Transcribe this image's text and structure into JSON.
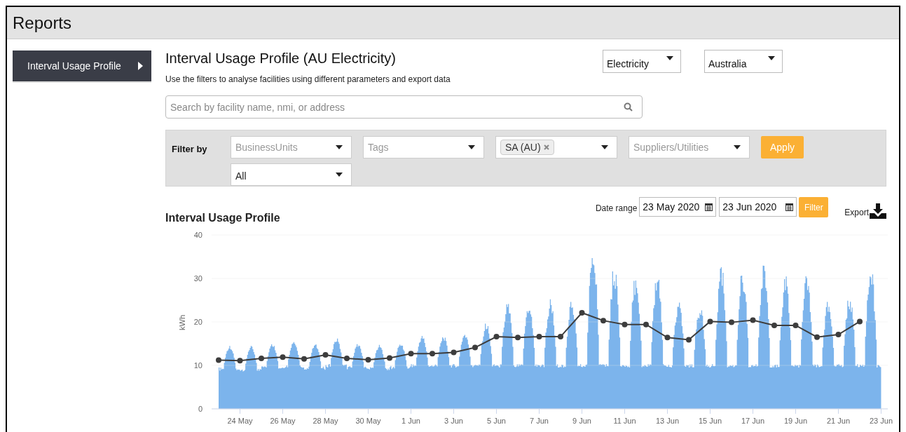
{
  "header": {
    "title": "Reports"
  },
  "sidebar": {
    "items": [
      {
        "label": "Interval Usage Profile",
        "selected": true
      }
    ]
  },
  "page": {
    "title": "Interval Usage Profile (AU Electricity)",
    "subtitle": "Use the filters to analyse facilities using different parameters and export data"
  },
  "selectors": [
    {
      "value": "Electricity"
    },
    {
      "value": "Australia"
    }
  ],
  "search": {
    "placeholder": "Search by facility name, nmi, or address"
  },
  "filter": {
    "label": "Filter by",
    "fields": [
      {
        "kind": "placeholder",
        "text": "BusinessUnits"
      },
      {
        "kind": "placeholder",
        "text": "Tags"
      },
      {
        "kind": "chips",
        "chips": [
          "SA (AU)"
        ]
      },
      {
        "kind": "placeholder",
        "text": "Suppliers/Utilities"
      },
      {
        "kind": "value",
        "text": "All"
      }
    ],
    "apply": "Apply"
  },
  "report": {
    "title": "Interval Usage Profile",
    "date_range": {
      "label": "Date range",
      "from": "23 May 2020",
      "to": "23 Jun 2020",
      "button": "Filter"
    },
    "export": "Export",
    "chart_data": {
      "type": "line",
      "ylabel": "kWh",
      "grid": true,
      "ylim": [
        0,
        40
      ],
      "yticks": [
        0,
        10,
        20,
        30,
        40
      ],
      "categories": [
        null,
        "24 May",
        null,
        "26 May",
        null,
        "28 May",
        null,
        "30 May",
        null,
        "1 Jun",
        null,
        "3 Jun",
        null,
        "5 Jun",
        null,
        "7 Jun",
        null,
        "9 Jun",
        null,
        "11 Jun",
        null,
        "13 Jun",
        null,
        "15 Jun",
        null,
        "17 Jun",
        null,
        "19 Jun",
        null,
        "21 Jun",
        null,
        "23 Jun"
      ],
      "series": [
        {
          "color": "#3d3d3d",
          "marker": true,
          "values": [
            11.2,
            11.1,
            11.6,
            11.9,
            11.5,
            12.4,
            11.6,
            11.3,
            11.7,
            12.7,
            12.7,
            13.0,
            14.1,
            16.6,
            16.4,
            16.6,
            16.6,
            22.1,
            20.3,
            19.4,
            19.4,
            16.4,
            15.9,
            20.1,
            19.9,
            20.4,
            19.2,
            19.2,
            16.5,
            17.1,
            20.1,
            null
          ]
        }
      ]
    }
  }
}
